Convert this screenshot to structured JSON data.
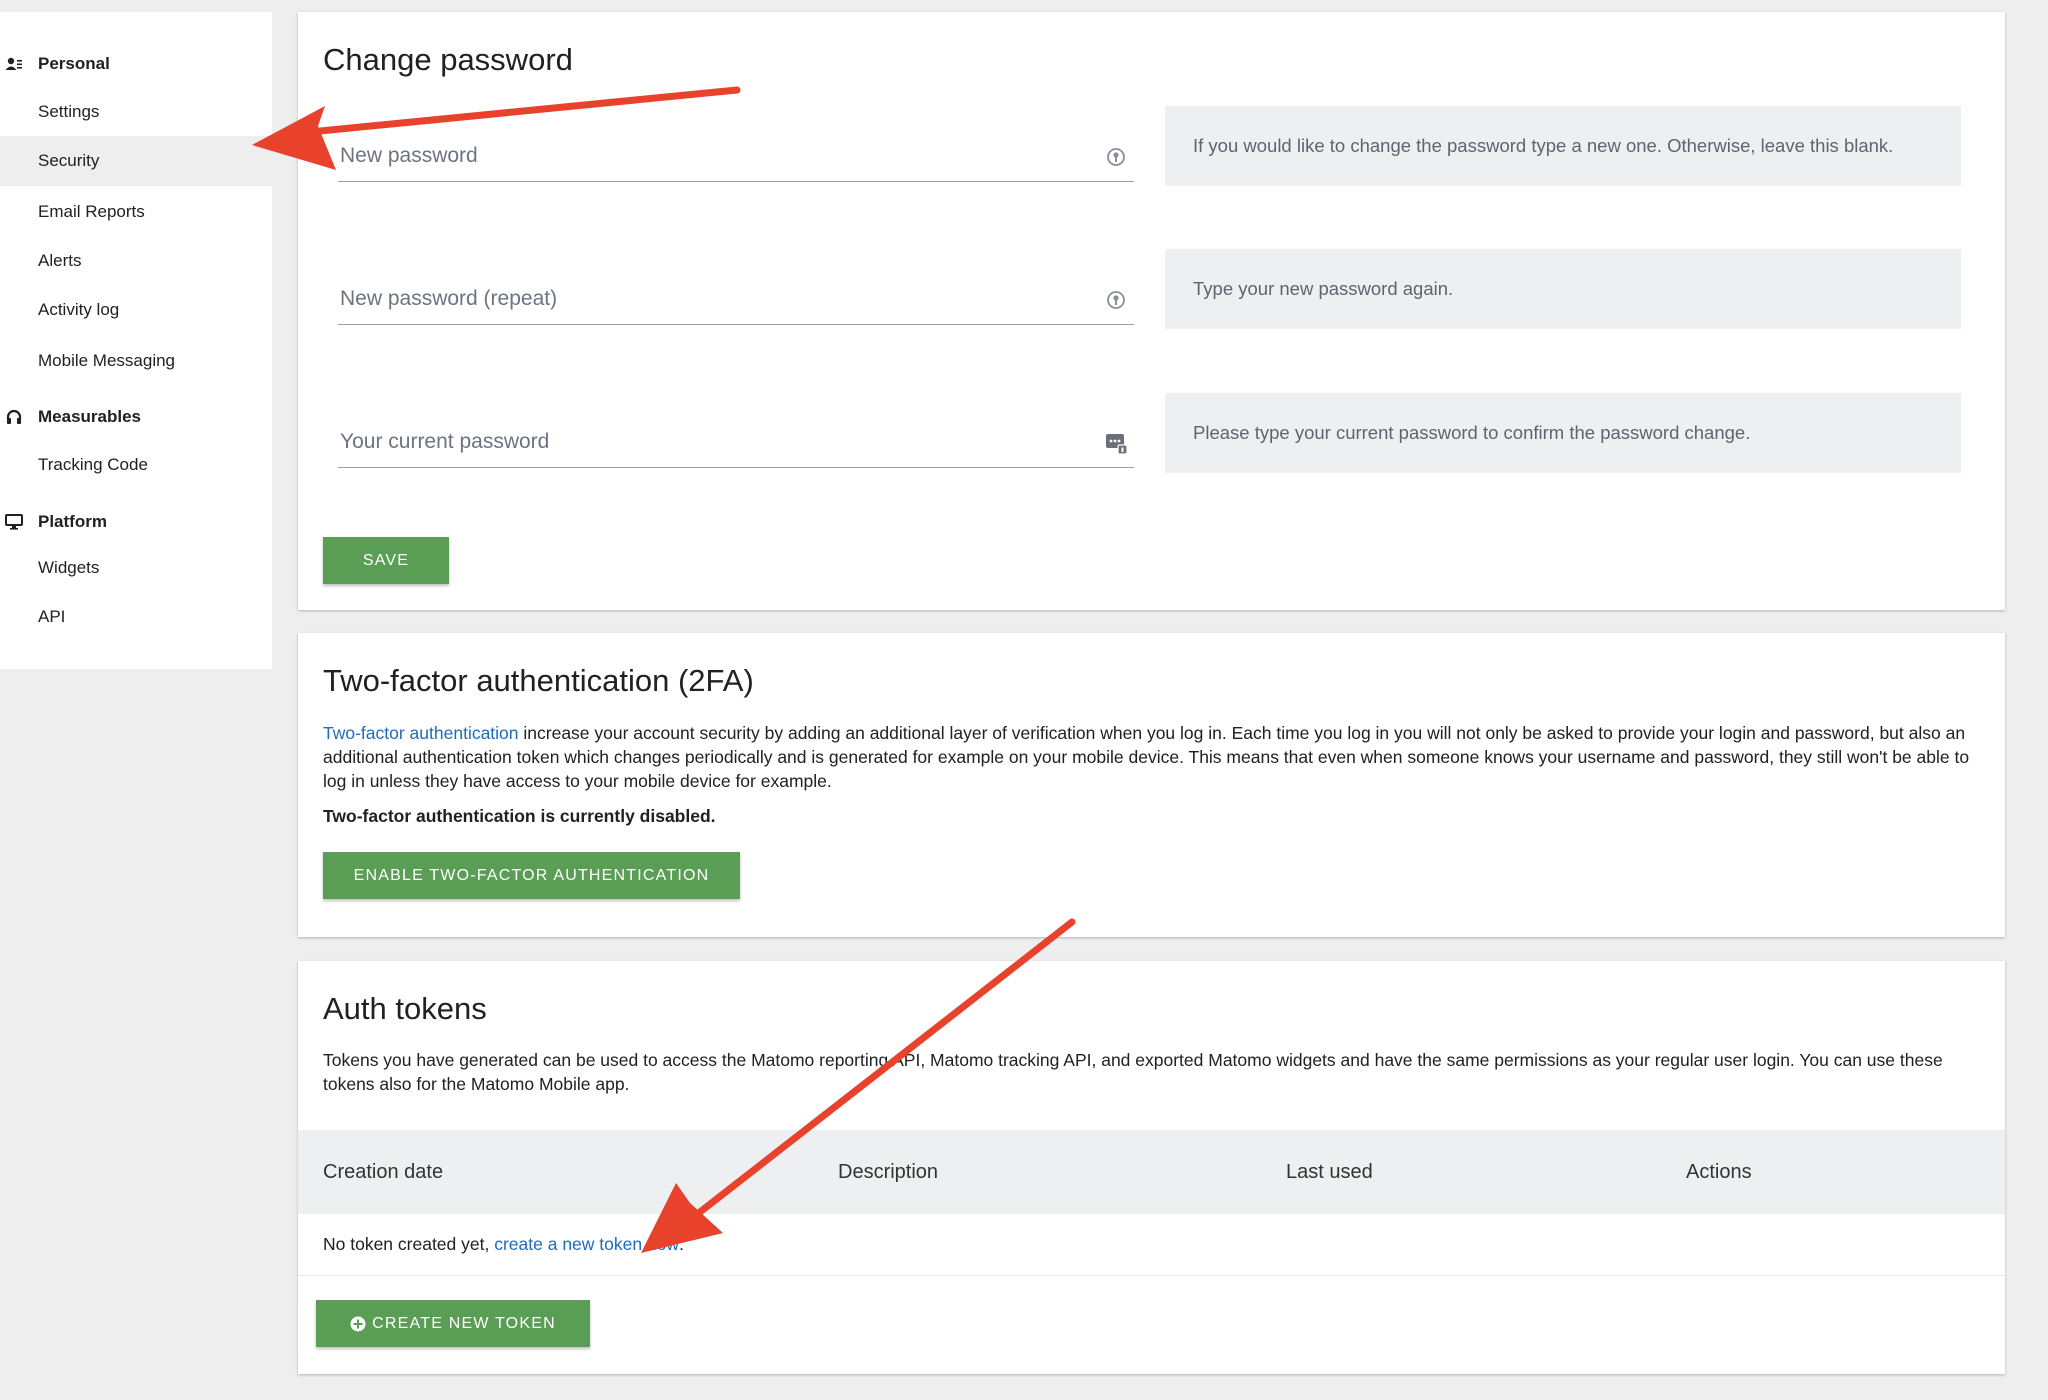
{
  "sidebar": {
    "sections": [
      {
        "icon": "user-card-icon",
        "label": "Personal",
        "items": [
          "Settings",
          "Security",
          "Email Reports",
          "Alerts",
          "Activity log",
          "Mobile Messaging"
        ],
        "active": "Security"
      },
      {
        "icon": "headset-icon",
        "label": "Measurables",
        "items": [
          "Tracking Code"
        ]
      },
      {
        "icon": "monitor-icon",
        "label": "Platform",
        "items": [
          "Widgets",
          "API"
        ]
      }
    ]
  },
  "change_password": {
    "title": "Change password",
    "fields": [
      {
        "placeholder": "New password",
        "help": "If you would like to change the password type a new one. Otherwise, leave this blank.",
        "icon": "key-icon"
      },
      {
        "placeholder": "New password (repeat)",
        "help": "Type your new password again.",
        "icon": "key-icon"
      },
      {
        "placeholder": "Your current password",
        "help": "Please type your current password to confirm the password change.",
        "icon": "password-dots-icon"
      }
    ],
    "save_label": "SAVE"
  },
  "two_factor": {
    "title": "Two-factor authentication (2FA)",
    "link_text": "Two-factor authentication",
    "description": " increase your account security by adding an additional layer of verification when you log in. Each time you log in you will not only be asked to provide your login and password, but also an additional authentication token which changes periodically and is generated for example on your mobile device. This means that even when someone knows your username and password, they still won't be able to log in unless they have access to your mobile device for example.",
    "status": "Two-factor authentication is currently disabled.",
    "enable_label": "ENABLE TWO-FACTOR AUTHENTICATION"
  },
  "auth_tokens": {
    "title": "Auth tokens",
    "description": "Tokens you have generated can be used to access the Matomo reporting API, Matomo tracking API, and exported Matomo widgets and have the same permissions as your regular user login. You can use these tokens also for the Matomo Mobile app.",
    "columns": [
      "Creation date",
      "Description",
      "Last used",
      "Actions"
    ],
    "empty_prefix": "No token created yet, ",
    "empty_link": "create a new token now",
    "empty_suffix": ".",
    "create_label": "CREATE NEW TOKEN",
    "create_icon": "plus-circle-icon"
  },
  "colors": {
    "button_green": "#5a9d54",
    "link_blue": "#1e6bbf",
    "arrow_red": "#e8412c"
  }
}
